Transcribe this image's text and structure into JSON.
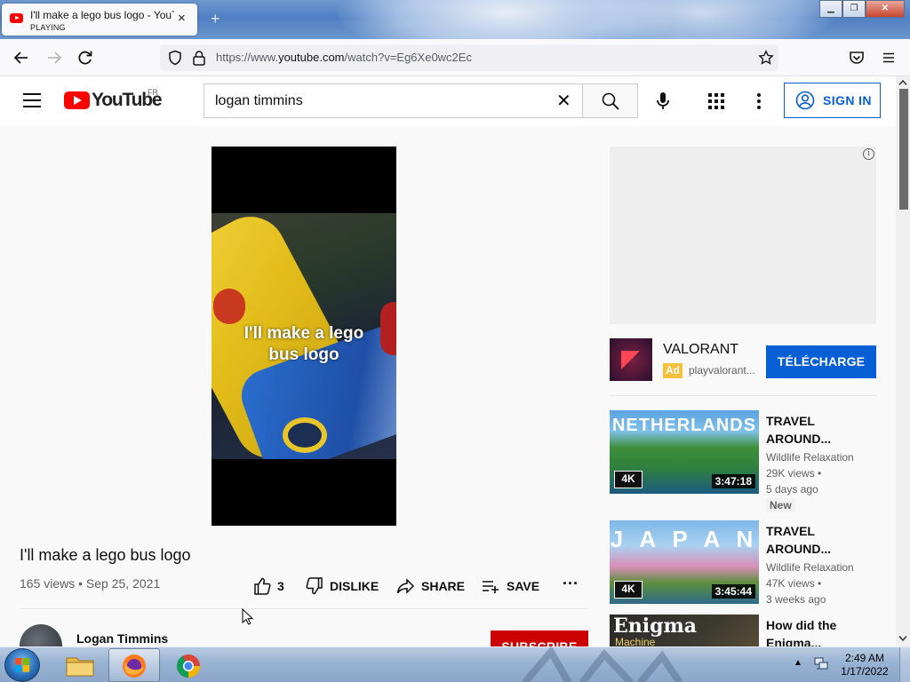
{
  "browser": {
    "tab": {
      "title": "I'll make a lego bus logo - YouT",
      "status": "PLAYING",
      "close": "×"
    },
    "new_tab": "+",
    "window_buttons": {
      "minimize": "▁",
      "restore": "❐",
      "close": "✕"
    },
    "url": {
      "prefix": "https://www.",
      "domain": "youtube.com",
      "path": "/watch?v=Eg6Xe0wc2Ec"
    }
  },
  "youtube": {
    "logo_text": "YouTube",
    "region": "FR",
    "search": {
      "value": "logan timmins",
      "clear": "✕"
    },
    "sign_in": "SIGN IN"
  },
  "video": {
    "overlay_caption_line1": "I'll make a lego",
    "overlay_caption_line2": "bus logo",
    "title": "I'll make a lego bus logo",
    "meta": "165 views • Sep 25, 2021",
    "like_count": "3",
    "dislike": "DISLIKE",
    "share": "SHARE",
    "save": "SAVE",
    "more": "...",
    "channel": "Logan Timmins",
    "subscribe": "SUBSCRIBE"
  },
  "sidebar": {
    "ad_info": "i",
    "promo": {
      "title": "VALORANT",
      "badge": "Ad",
      "domain": "playvalorant...",
      "button": "TÉLÉCHARGE"
    },
    "recommendations": [
      {
        "thumb_text": "NETHERLANDS",
        "badge": "4K",
        "duration": "3:47:18",
        "title_line1": "TRAVEL",
        "title_line2": "AROUND...",
        "channel": "Wildlife Relaxation",
        "views": "29K views •",
        "age": "5 days ago",
        "tag": "New"
      },
      {
        "thumb_text": "J A P A N",
        "badge": "4K",
        "duration": "3:45:44",
        "title_line1": "TRAVEL",
        "title_line2": "AROUND...",
        "channel": "Wildlife Relaxation",
        "views": "47K views •",
        "age": "3 weeks ago"
      },
      {
        "thumb_text": "Enigma",
        "thumb_sub": "Machine",
        "title_line1": "How did the",
        "title_line2": "Enigma..."
      }
    ]
  },
  "taskbar": {
    "time": "2:49 AM",
    "date": "1/17/2022",
    "tray_arrow": "▲"
  },
  "colors": {
    "youtube_red": "#ff0000",
    "link_blue": "#065fd4",
    "subscribe_red": "#cc0000",
    "ad_yellow": "#f9c13b"
  }
}
